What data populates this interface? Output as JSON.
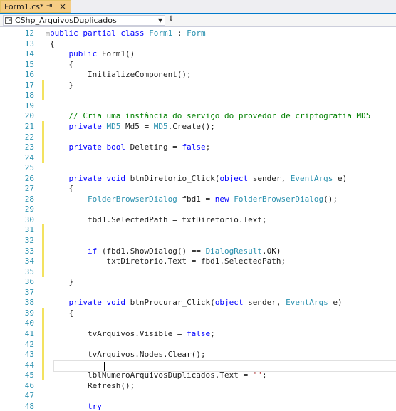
{
  "tab": {
    "title": "Form1.cs*",
    "pin": "⇥",
    "close": "×"
  },
  "navbar": {
    "class_combo": "CShp_ArquivosDuplicados",
    "cs_icon_label": "C#"
  },
  "editor": {
    "lines": [
      {
        "n": "12",
        "parts": [
          [
            "k",
            "public partial class "
          ],
          [
            "t",
            "Form1"
          ],
          [
            "p",
            " : "
          ],
          [
            "t",
            "Form"
          ]
        ]
      },
      {
        "n": "13",
        "parts": [
          [
            "p",
            "{"
          ]
        ]
      },
      {
        "n": "14",
        "parts": [
          [
            "k",
            "    public "
          ],
          [
            "p",
            "Form1()"
          ]
        ]
      },
      {
        "n": "15",
        "parts": [
          [
            "p",
            "    {"
          ]
        ]
      },
      {
        "n": "16",
        "parts": [
          [
            "p",
            "        InitializeComponent();"
          ]
        ]
      },
      {
        "n": "17",
        "parts": [
          [
            "p",
            "    }"
          ]
        ]
      },
      {
        "n": "18",
        "parts": []
      },
      {
        "n": "19",
        "parts": []
      },
      {
        "n": "20",
        "parts": [
          [
            "c",
            "    // Cria uma instância do serviço do provedor de criptografia MD5"
          ]
        ]
      },
      {
        "n": "21",
        "parts": [
          [
            "k",
            "    private "
          ],
          [
            "t",
            "MD5"
          ],
          [
            "p",
            " Md5 = "
          ],
          [
            "t",
            "MD5"
          ],
          [
            "p",
            ".Create();"
          ]
        ]
      },
      {
        "n": "22",
        "parts": []
      },
      {
        "n": "23",
        "parts": [
          [
            "k",
            "    private bool "
          ],
          [
            "p",
            "Deleting = "
          ],
          [
            "k",
            "false"
          ],
          [
            "p",
            ";"
          ]
        ]
      },
      {
        "n": "24",
        "parts": []
      },
      {
        "n": "25",
        "parts": []
      },
      {
        "n": "26",
        "parts": [
          [
            "k",
            "    private void "
          ],
          [
            "p",
            "btnDiretorio_Click("
          ],
          [
            "k",
            "object "
          ],
          [
            "p",
            "sender, "
          ],
          [
            "t",
            "EventArgs"
          ],
          [
            "p",
            " e)"
          ]
        ]
      },
      {
        "n": "27",
        "parts": [
          [
            "p",
            "    {"
          ]
        ]
      },
      {
        "n": "28",
        "parts": [
          [
            "t",
            "        FolderBrowserDialog"
          ],
          [
            "p",
            " fbd1 = "
          ],
          [
            "k",
            "new "
          ],
          [
            "t",
            "FolderBrowserDialog"
          ],
          [
            "p",
            "();"
          ]
        ]
      },
      {
        "n": "29",
        "parts": []
      },
      {
        "n": "30",
        "parts": [
          [
            "p",
            "        fbd1.SelectedPath = txtDiretorio.Text;"
          ]
        ]
      },
      {
        "n": "31",
        "parts": []
      },
      {
        "n": "32",
        "parts": []
      },
      {
        "n": "33",
        "parts": [
          [
            "k",
            "        if "
          ],
          [
            "p",
            "(fbd1.ShowDialog() == "
          ],
          [
            "t",
            "DialogResult"
          ],
          [
            "p",
            ".OK)"
          ]
        ]
      },
      {
        "n": "34",
        "parts": [
          [
            "p",
            "            txtDiretorio.Text = fbd1.SelectedPath;"
          ]
        ]
      },
      {
        "n": "35",
        "parts": []
      },
      {
        "n": "36",
        "parts": [
          [
            "p",
            "    }"
          ]
        ]
      },
      {
        "n": "37",
        "parts": []
      },
      {
        "n": "38",
        "parts": [
          [
            "k",
            "    private void "
          ],
          [
            "p",
            "btnProcurar_Click("
          ],
          [
            "k",
            "object "
          ],
          [
            "p",
            "sender, "
          ],
          [
            "t",
            "EventArgs"
          ],
          [
            "p",
            " e)"
          ]
        ]
      },
      {
        "n": "39",
        "parts": [
          [
            "p",
            "    {"
          ]
        ]
      },
      {
        "n": "40",
        "parts": []
      },
      {
        "n": "41",
        "parts": [
          [
            "p",
            "        tvArquivos.Visible = "
          ],
          [
            "k",
            "false"
          ],
          [
            "p",
            ";"
          ]
        ]
      },
      {
        "n": "42",
        "parts": []
      },
      {
        "n": "43",
        "parts": [
          [
            "p",
            "        tvArquivos.Nodes.Clear();"
          ]
        ]
      },
      {
        "n": "44",
        "parts": []
      },
      {
        "n": "45",
        "parts": [
          [
            "p",
            "        lblNumeroArquivosDuplicados.Text = "
          ],
          [
            "s",
            "\"\""
          ],
          [
            "p",
            ";"
          ]
        ]
      },
      {
        "n": "46",
        "parts": [
          [
            "p",
            "        Refresh();"
          ]
        ]
      },
      {
        "n": "47",
        "parts": []
      },
      {
        "n": "48",
        "parts": [
          [
            "k",
            "        try"
          ]
        ]
      }
    ],
    "outline_marker": "⊟",
    "changed_lines": [
      "17",
      "18",
      "21",
      "22",
      "23",
      "24",
      "31",
      "32",
      "33",
      "34",
      "35",
      "39",
      "40",
      "41",
      "42",
      "43",
      "44",
      "45"
    ]
  },
  "colors": {
    "keyword": "#0000ff",
    "type": "#2b91af",
    "comment": "#008000",
    "string": "#a31515",
    "change_bar": "#f3e260",
    "accent": "#007acc"
  }
}
